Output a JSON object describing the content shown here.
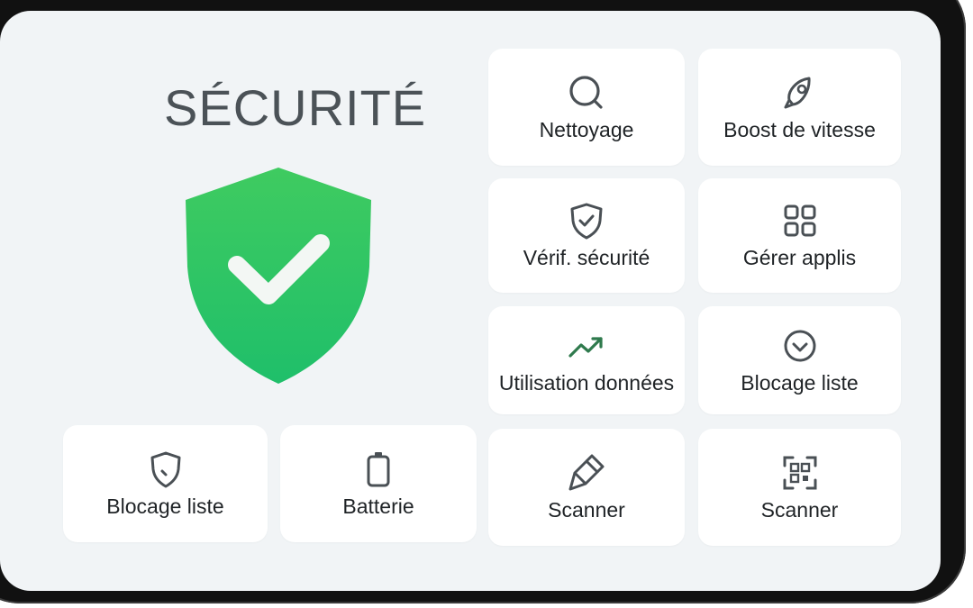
{
  "screen": {
    "title": "SÉCURITÉ",
    "accent": "#2fc462",
    "icon_color": "#4a5055",
    "status_icon": "shield-check-icon"
  },
  "tiles": [
    {
      "label": "Nettoyage",
      "icon": "magnifier-icon"
    },
    {
      "label": "Boost de vitesse",
      "icon": "rocket-icon"
    },
    {
      "label": "Vérif. sécurité",
      "icon": "shield-check-icon"
    },
    {
      "label": "Gérer applis",
      "icon": "grid-icon"
    },
    {
      "label": "Utilisation données",
      "icon": "trend-up-icon"
    },
    {
      "label": "Blocage liste",
      "icon": "circle-check-icon"
    },
    {
      "label": "Blocage liste",
      "icon": "shield-icon"
    },
    {
      "label": "Batterie",
      "icon": "battery-icon"
    },
    {
      "label": "Scanner",
      "icon": "flashlight-icon"
    },
    {
      "label": "Scanner",
      "icon": "qr-scan-icon"
    }
  ]
}
